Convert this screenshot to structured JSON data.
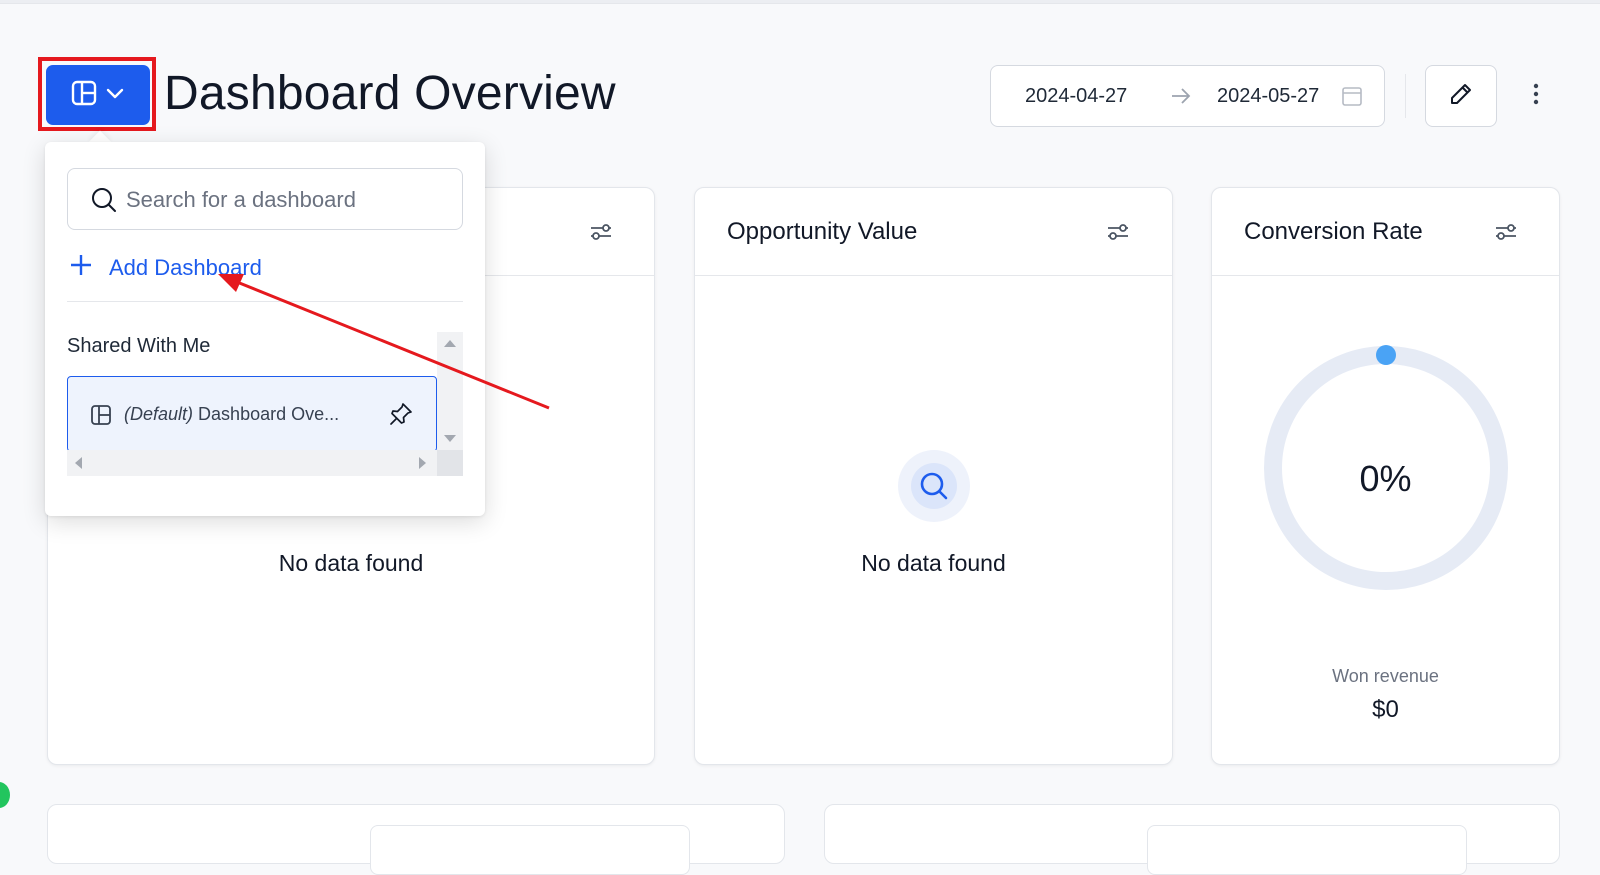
{
  "header": {
    "title": "Dashboard Overview",
    "date_start": "2024-04-27",
    "date_end": "2024-05-27"
  },
  "dropdown": {
    "search_placeholder": "Search for a dashboard",
    "add_label": "Add Dashboard",
    "section_label": "Shared With Me",
    "items": [
      {
        "prefix": "(Default)",
        "name": "Dashboard Ove..."
      }
    ]
  },
  "cards": {
    "first": {
      "nodata": "No data found"
    },
    "opportunity": {
      "title": "Opportunity Value",
      "nodata": "No data found"
    },
    "conversion": {
      "title": "Conversion Rate",
      "percent": "0%",
      "won_label": "Won revenue",
      "won_value": "$0"
    }
  },
  "colors": {
    "accent": "#1d5ced",
    "annotation": "#e5191e",
    "gauge_track": "#e6ebf5",
    "gauge_dot": "#4aa3f5"
  }
}
